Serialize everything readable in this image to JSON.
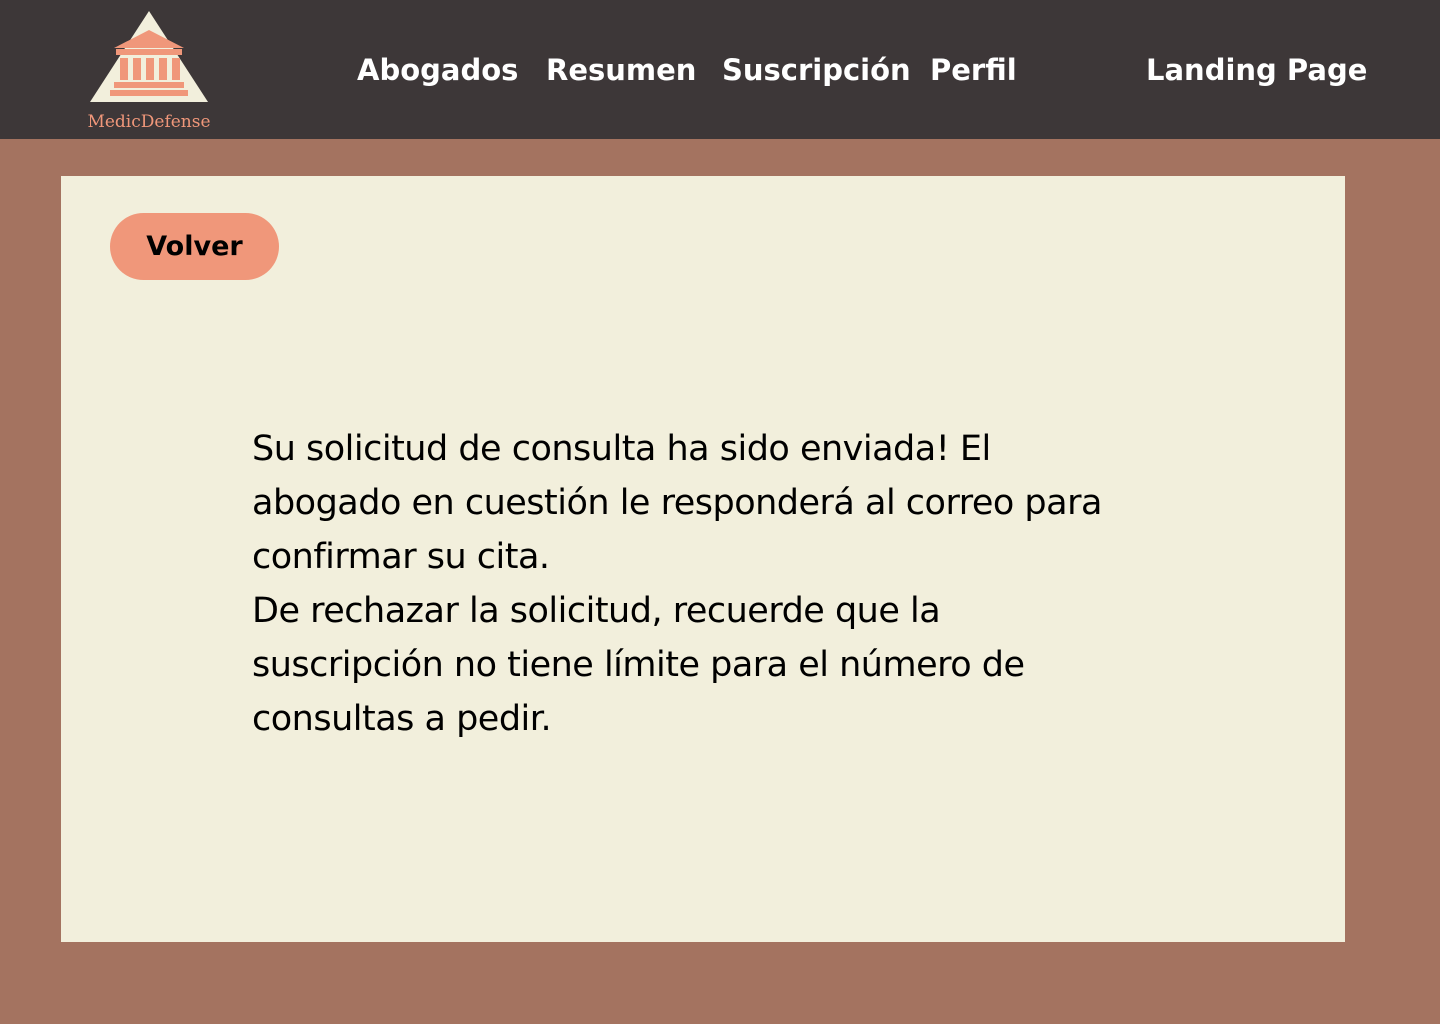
{
  "brand": {
    "name": "MedicDefense",
    "icon": "courthouse-icon",
    "colors": {
      "accent": "#f0977a",
      "triangle": "#f2efdc"
    }
  },
  "nav": {
    "items": [
      {
        "label": "Abogados"
      },
      {
        "label": "Resumen"
      },
      {
        "label": "Suscripción"
      },
      {
        "label": "Perfil"
      },
      {
        "label": "Landing Page"
      }
    ]
  },
  "content": {
    "back_label": "Volver",
    "message_paragraphs": [
      "Su solicitud de consulta ha sido enviada! El abogado en cuestión le responderá al correo para confirmar su cita.",
      "De rechazar la solicitud, recuerde que la suscripción no tiene límite para el número de consultas a pedir."
    ]
  },
  "colors": {
    "page_background": "#a47360",
    "navbar_background": "#3d3738",
    "panel_background": "#f2efdc",
    "button_background": "#f0977a"
  }
}
